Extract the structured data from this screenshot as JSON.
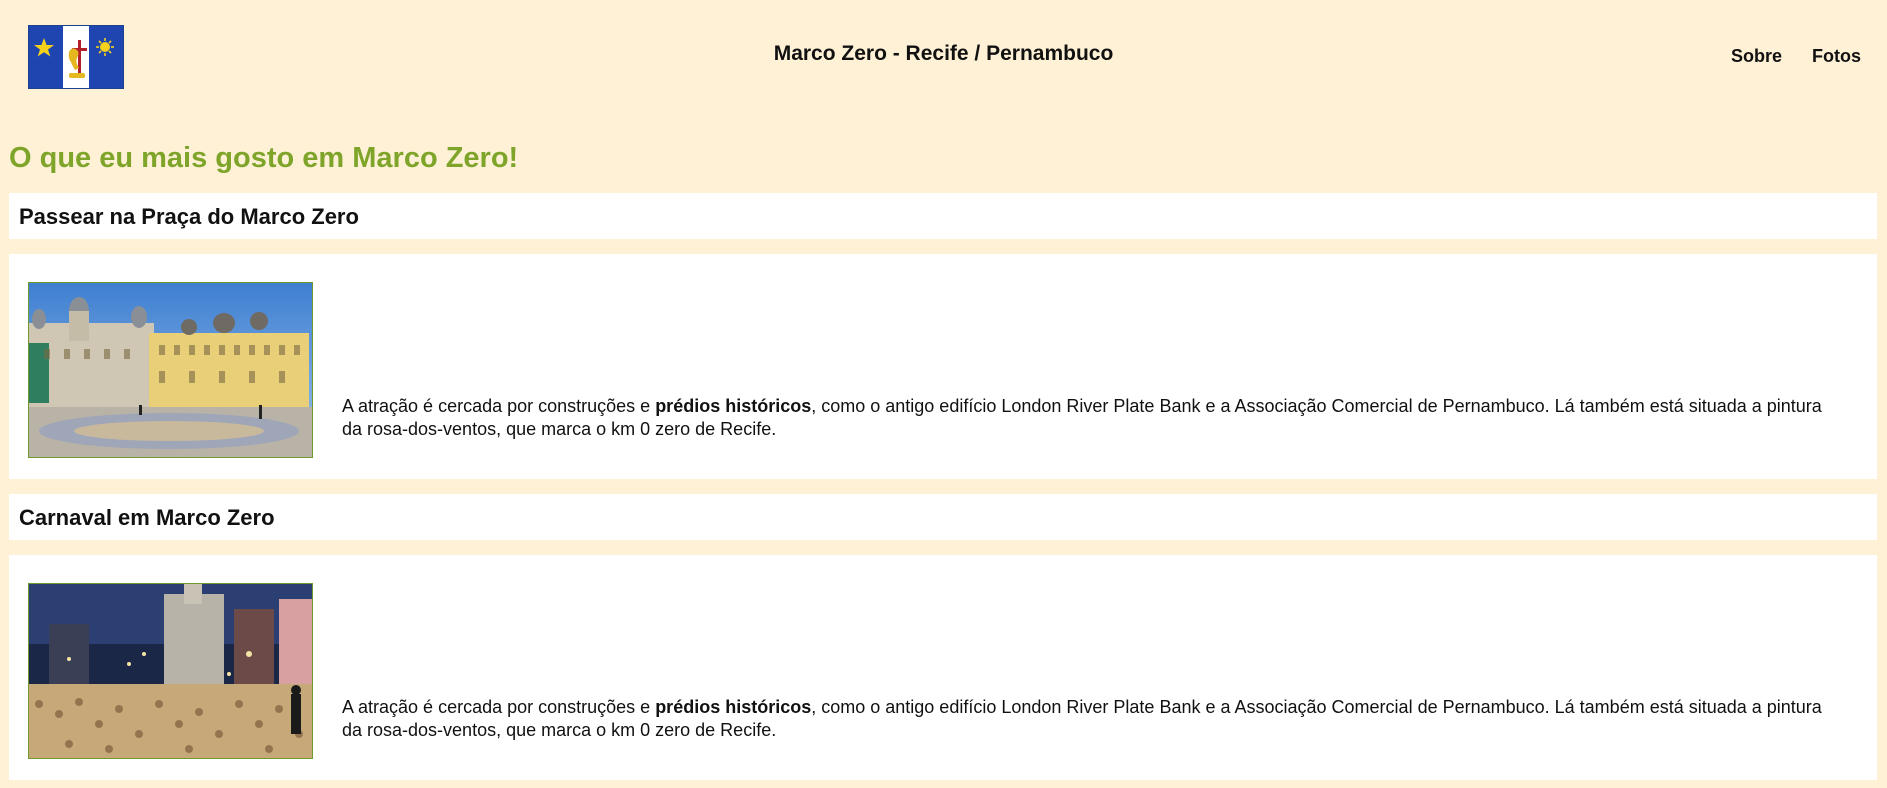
{
  "header": {
    "title": "Marco Zero - Recife / Pernambuco",
    "nav": [
      "Sobre",
      "Fotos"
    ]
  },
  "main": {
    "heading": "O que eu mais gosto em Marco Zero!",
    "sections": [
      {
        "title": "Passear na Praça do Marco Zero",
        "desc_before": "A atração é cercada por construções e ",
        "desc_bold": "prédios históricos",
        "desc_after": ", como o antigo edifício London River Plate Bank e a Associação Comercial de Pernambuco. Lá também está situada a pintura da rosa-dos-ventos, que marca o km 0 zero de Recife."
      },
      {
        "title": "Carnaval em Marco Zero",
        "desc_before": "A atração é cercada por construções e ",
        "desc_bold": "prédios históricos",
        "desc_after": ", como o antigo edifício London River Plate Bank e a Associação Comercial de Pernambuco. Lá também está situada a pintura da rosa-dos-ventos, que marca o km 0 zero de Recife."
      }
    ]
  },
  "colors": {
    "background": "#fff1d6",
    "heading": "#7ea52a",
    "flag_blue": "#1f45b0"
  }
}
